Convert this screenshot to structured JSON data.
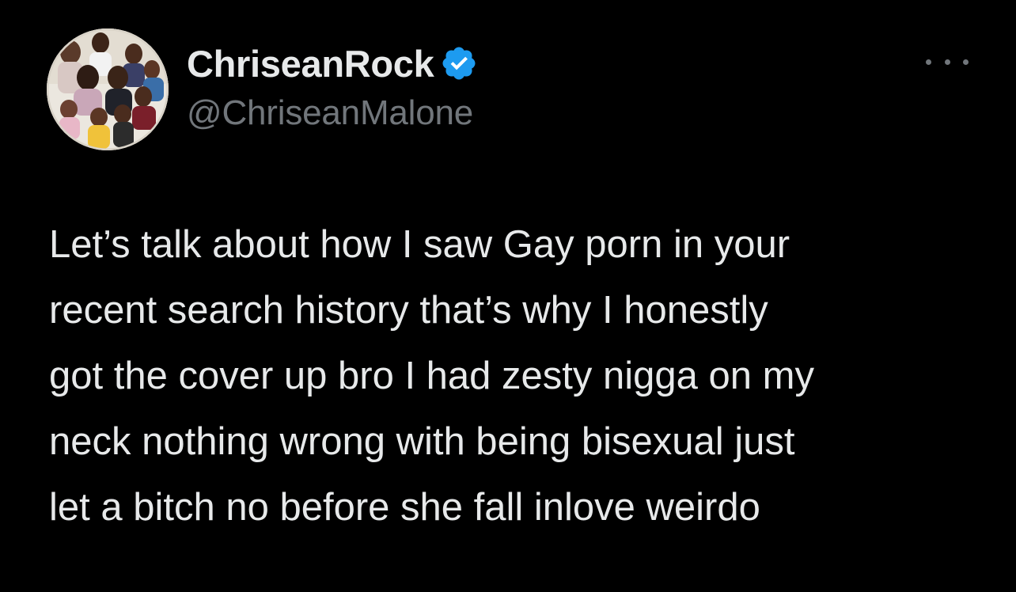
{
  "tweet": {
    "display_name": "ChriseanRock",
    "handle": "@ChriseanMalone",
    "verified": true,
    "avatar_icon": "family-photo-avatar",
    "more_icon": "more-options-icon",
    "text_lines": [
      "Let’s talk about how I saw Gay porn in your",
      "recent search history that’s why I honestly",
      "got the cover up bro I had zesty nigga on my",
      "neck nothing wrong with being bisexual just",
      "let a bitch no before she fall inlove weirdo"
    ]
  },
  "colors": {
    "background": "#000000",
    "primary_text": "#e7e9ea",
    "secondary_text": "#71767b",
    "verified_badge": "#1d9bf0"
  }
}
